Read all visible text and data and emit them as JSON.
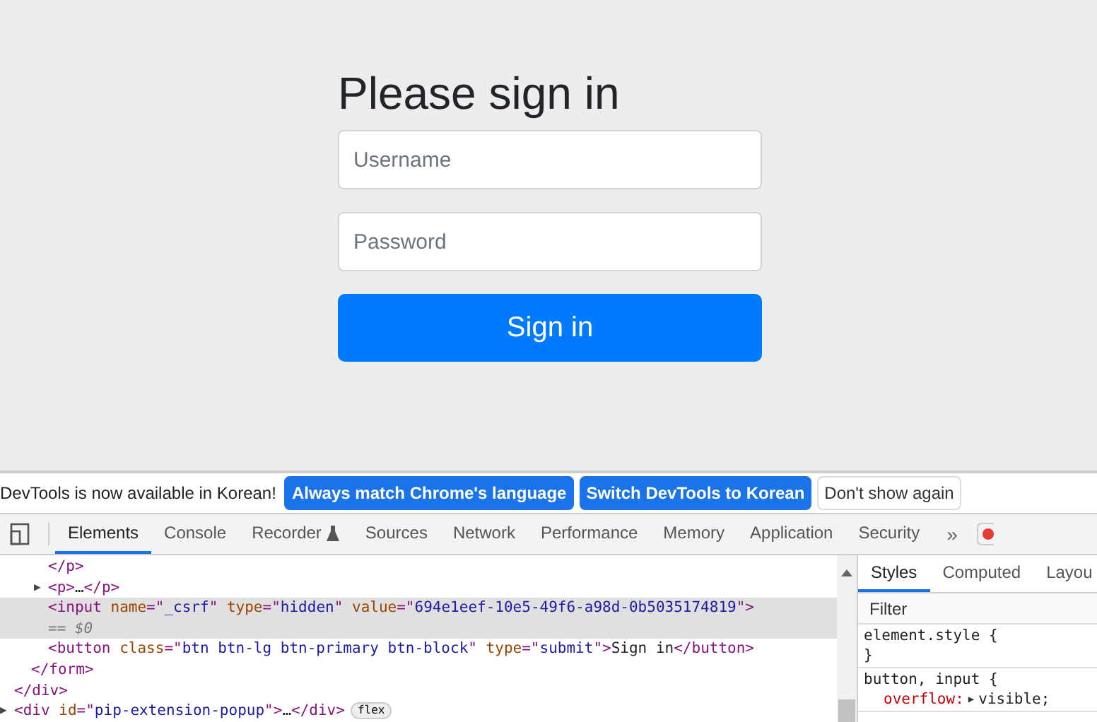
{
  "signin": {
    "title": "Please sign in",
    "username": {
      "placeholder": "Username"
    },
    "password": {
      "placeholder": "Password"
    },
    "button": "Sign in"
  },
  "banner": {
    "message": "DevTools is now available in Korean!",
    "buttons": [
      {
        "label": "Always match Chrome's language",
        "primary": true
      },
      {
        "label": "Switch DevTools to Korean",
        "primary": true
      },
      {
        "label": "Don't show again",
        "primary": false
      }
    ]
  },
  "devtools_tabs": [
    {
      "label": "Elements",
      "selected": true
    },
    {
      "label": "Console",
      "selected": false
    },
    {
      "label": "Recorder",
      "selected": false,
      "experimental": true
    },
    {
      "label": "Sources",
      "selected": false
    },
    {
      "label": "Network",
      "selected": false
    },
    {
      "label": "Performance",
      "selected": false
    },
    {
      "label": "Memory",
      "selected": false
    },
    {
      "label": "Application",
      "selected": false
    },
    {
      "label": "Security",
      "selected": false
    }
  ],
  "more_tabs": "»",
  "dom_tree": [
    {
      "children": [
        {
          "children": [
            {
              "selected": false,
              "tokens": [
                {
                  "kind": "tag",
                  "text": "</p>"
                }
              ]
            },
            {
              "selected": false,
              "arrow": "▶",
              "tokens": [
                {
                  "kind": "tag",
                  "text": "<p>"
                },
                {
                  "kind": "text",
                  "text": "…"
                },
                {
                  "kind": "tag",
                  "text": "</p>"
                }
              ]
            },
            {
              "selected": true,
              "tokens": [
                {
                  "kind": "tag",
                  "text": "<input"
                },
                {
                  "kind": "attr",
                  "text": " name"
                },
                {
                  "kind": "tag",
                  "text": "=\""
                },
                {
                  "kind": "value",
                  "text": "_csrf"
                },
                {
                  "kind": "tag",
                  "text": "\""
                },
                {
                  "kind": "attr",
                  "text": " type"
                },
                {
                  "kind": "tag",
                  "text": "=\""
                },
                {
                  "kind": "value",
                  "text": "hidden"
                },
                {
                  "kind": "tag",
                  "text": "\""
                },
                {
                  "kind": "attr",
                  "text": " value"
                },
                {
                  "kind": "tag",
                  "text": "=\""
                },
                {
                  "kind": "value",
                  "text": "694e1eef-10e5-49f6-a98d-0b5035174819"
                },
                {
                  "kind": "tag",
                  "text": "\">"
                }
              ]
            },
            {
              "selected": true,
              "tokens": [
                {
                  "kind": "comment",
                  "text": " == $0"
                }
              ]
            },
            {
              "selected": false,
              "tokens": [
                {
                  "kind": "tag",
                  "text": "<button"
                },
                {
                  "kind": "attr",
                  "text": " class"
                },
                {
                  "kind": "tag",
                  "text": "=\""
                },
                {
                  "kind": "value",
                  "text": "btn btn-lg btn-primary btn-block"
                },
                {
                  "kind": "tag",
                  "text": "\""
                },
                {
                  "kind": "attr",
                  "text": " type"
                },
                {
                  "kind": "tag",
                  "text": "=\""
                },
                {
                  "kind": "value",
                  "text": "submit"
                },
                {
                  "kind": "tag",
                  "text": "\">"
                },
                {
                  "kind": "text",
                  "text": "Sign in"
                },
                {
                  "kind": "tag",
                  "text": "</button>"
                }
              ]
            }
          ]
        },
        {
          "selected": false,
          "tokens": [
            {
              "kind": "tag",
              "text": "</form>"
            }
          ]
        }
      ]
    },
    {
      "selected": false,
      "tokens": [
        {
          "kind": "tag",
          "text": "</div>"
        }
      ]
    },
    {
      "selected": false,
      "arrow": "▶",
      "tokens": [
        {
          "kind": "tag",
          "text": "<div"
        },
        {
          "kind": "attr",
          "text": " id"
        },
        {
          "kind": "tag",
          "text": "=\""
        },
        {
          "kind": "value",
          "text": "pip-extension-popup"
        },
        {
          "kind": "tag",
          "text": "\">"
        },
        {
          "kind": "text",
          "text": "…"
        },
        {
          "kind": "tag",
          "text": "</div>"
        }
      ],
      "badge": "flex"
    }
  ],
  "styles_tabs": [
    {
      "label": "Styles",
      "selected": true
    },
    {
      "label": "Computed",
      "selected": false
    },
    {
      "label": "Layou",
      "selected": false
    }
  ],
  "filter": {
    "placeholder": "Filter"
  },
  "rules": [
    {
      "selector": "element.style {",
      "close": "}"
    },
    {
      "selector": "button, input {",
      "props": [
        {
          "name": "overflow:",
          "value": "visible;"
        }
      ]
    }
  ]
}
